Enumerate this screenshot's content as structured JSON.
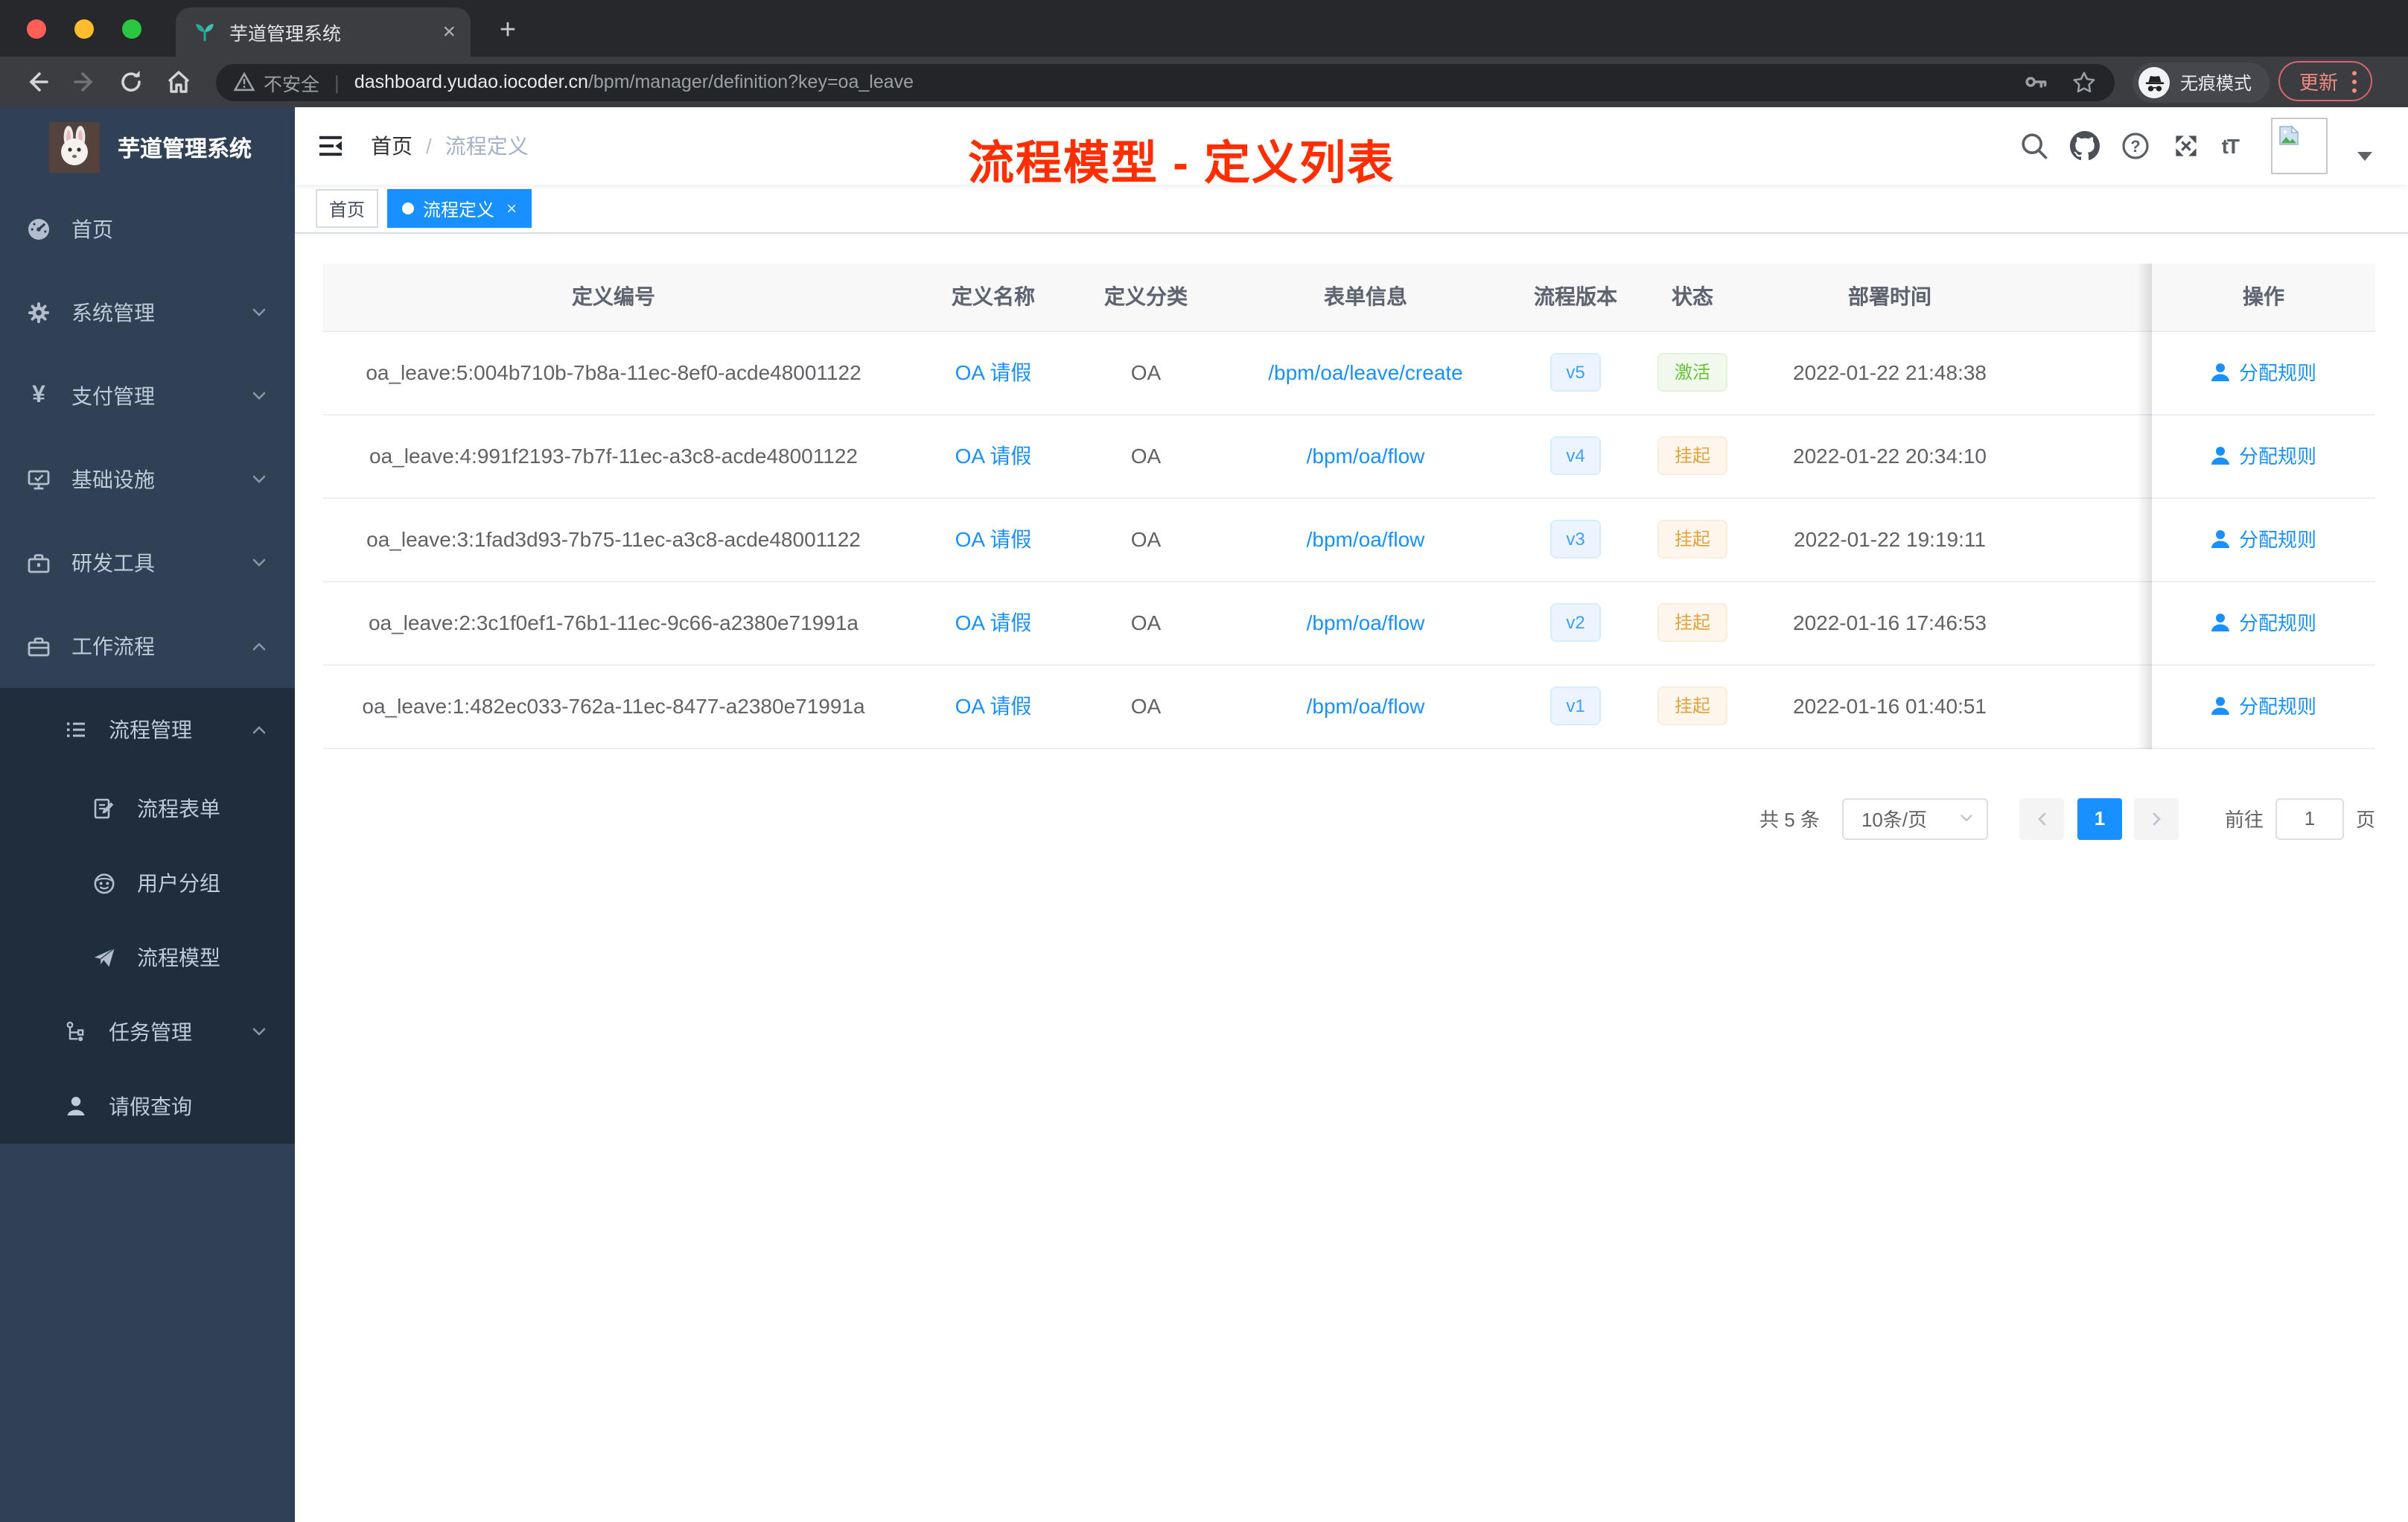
{
  "browser": {
    "tab_title": "芋道管理系统",
    "security_label": "不安全",
    "url_host": "dashboard.yudao.iocoder.cn",
    "url_path": "/bpm/manager/definition?key=oa_leave",
    "incognito_label": "无痕模式",
    "update_label": "更新"
  },
  "icons": {
    "tab_close": "×",
    "new_tab": "+",
    "tag_close": "×",
    "yen": "¥",
    "font_size": "tT",
    "help_mark": "?",
    "breadcrumb_sep": "/",
    "prev_arrow": "‹",
    "next_arrow": "›"
  },
  "sidebar": {
    "logo_title": "芋道管理系统",
    "items": [
      {
        "label": "首页"
      },
      {
        "label": "系统管理"
      },
      {
        "label": "支付管理"
      },
      {
        "label": "基础设施"
      },
      {
        "label": "研发工具"
      },
      {
        "label": "工作流程"
      },
      {
        "label": "流程管理"
      },
      {
        "label": "流程表单"
      },
      {
        "label": "用户分组"
      },
      {
        "label": "流程模型"
      },
      {
        "label": "任务管理"
      },
      {
        "label": "请假查询"
      }
    ]
  },
  "header": {
    "breadcrumb_home": "首页",
    "breadcrumb_current": "流程定义"
  },
  "annotation": "流程模型 - 定义列表",
  "tags": {
    "home": "首页",
    "active": "流程定义"
  },
  "table": {
    "columns": [
      "定义编号",
      "定义名称",
      "定义分类",
      "表单信息",
      "流程版本",
      "状态",
      "部署时间",
      "操作"
    ],
    "rows": [
      {
        "id": "oa_leave:5:004b710b-7b8a-11ec-8ef0-acde48001122",
        "name": "OA 请假",
        "category": "OA",
        "form": "/bpm/oa/leave/create",
        "version": "v5",
        "status": "激活",
        "time": "2022-01-22 21:48:38",
        "action": "分配规则"
      },
      {
        "id": "oa_leave:4:991f2193-7b7f-11ec-a3c8-acde48001122",
        "name": "OA 请假",
        "category": "OA",
        "form": "/bpm/oa/flow",
        "version": "v4",
        "status": "挂起",
        "time": "2022-01-22 20:34:10",
        "action": "分配规则"
      },
      {
        "id": "oa_leave:3:1fad3d93-7b75-11ec-a3c8-acde48001122",
        "name": "OA 请假",
        "category": "OA",
        "form": "/bpm/oa/flow",
        "version": "v3",
        "status": "挂起",
        "time": "2022-01-22 19:19:11",
        "action": "分配规则"
      },
      {
        "id": "oa_leave:2:3c1f0ef1-76b1-11ec-9c66-a2380e71991a",
        "name": "OA 请假",
        "category": "OA",
        "form": "/bpm/oa/flow",
        "version": "v2",
        "status": "挂起",
        "time": "2022-01-16 17:46:53",
        "action": "分配规则"
      },
      {
        "id": "oa_leave:1:482ec033-762a-11ec-8477-a2380e71991a",
        "name": "OA 请假",
        "category": "OA",
        "form": "/bpm/oa/flow",
        "version": "v1",
        "status": "挂起",
        "time": "2022-01-16 01:40:51",
        "action": "分配规则"
      }
    ]
  },
  "pagination": {
    "total": "共 5 条",
    "page_size": "10条/页",
    "page": "1",
    "goto_label": "前往",
    "goto_value": "1",
    "goto_unit": "页"
  }
}
